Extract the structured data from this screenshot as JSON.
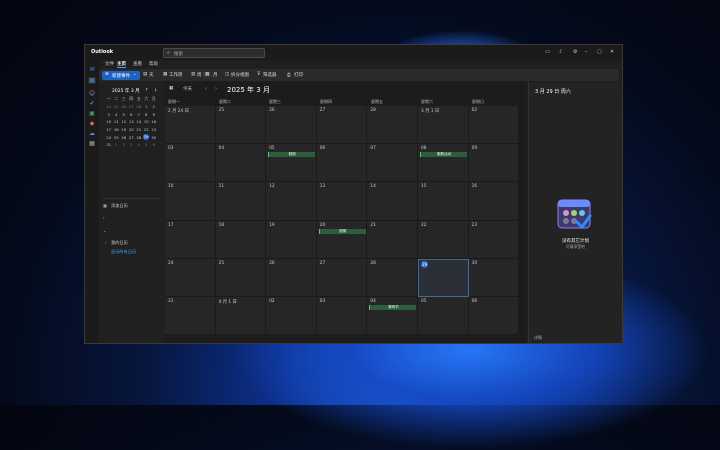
{
  "app": {
    "title": "Outlook"
  },
  "search": {
    "placeholder": "搜索"
  },
  "ribbon": {
    "tabs": [
      "文件",
      "主页",
      "查看",
      "帮助"
    ],
    "active_index": 1
  },
  "toolbar": {
    "new_event": "新建事件",
    "day": "天",
    "work_week": "工作周",
    "week": "周",
    "month": "月",
    "split_view": "拆分视图",
    "filter": "筛选器",
    "print": "打印"
  },
  "mini_calendar": {
    "title": "2025 年 3 月",
    "dows": [
      "一",
      "二",
      "三",
      "四",
      "五",
      "六",
      "日"
    ],
    "weeks": [
      [
        "24",
        "25",
        "26",
        "27",
        "28",
        "1",
        "2"
      ],
      [
        "3",
        "4",
        "5",
        "6",
        "7",
        "8",
        "9"
      ],
      [
        "10",
        "11",
        "12",
        "13",
        "14",
        "15",
        "16"
      ],
      [
        "17",
        "18",
        "19",
        "20",
        "21",
        "22",
        "23"
      ],
      [
        "24",
        "25",
        "26",
        "27",
        "28",
        "29",
        "30"
      ],
      [
        "31",
        "1",
        "2",
        "3",
        "4",
        "5",
        "6"
      ]
    ],
    "selected": "29"
  },
  "nav": {
    "add_calendar": "添加日历",
    "my_calendars": "我的日历",
    "show_all": "显示所有日历"
  },
  "calendar": {
    "today_label": "今天",
    "month_title": "2025 年 3 月",
    "dow": [
      "星期一",
      "星期二",
      "星期三",
      "星期四",
      "星期五",
      "星期六",
      "星期日"
    ],
    "weeks": [
      [
        "2 月 24 日",
        "25",
        "26",
        "27",
        "28",
        "3 月 1 日",
        "02"
      ],
      [
        "03",
        "04",
        "05",
        "06",
        "07",
        "08",
        "09"
      ],
      [
        "10",
        "11",
        "12",
        "13",
        "14",
        "15",
        "16"
      ],
      [
        "17",
        "18",
        "19",
        "20",
        "21",
        "22",
        "23"
      ],
      [
        "24",
        "25",
        "26",
        "27",
        "28",
        "29",
        "30"
      ],
      [
        "31",
        "4 月 1 日",
        "02",
        "03",
        "04",
        "05",
        "06"
      ]
    ],
    "today_cell": "29",
    "events": [
      {
        "week": 1,
        "day": 2,
        "label": "假期"
      },
      {
        "week": 1,
        "day": 5,
        "label": "假期活动"
      },
      {
        "week": 3,
        "day": 3,
        "label": "假期"
      },
      {
        "week": 5,
        "day": 4,
        "label": "清明节"
      }
    ]
  },
  "right_pane": {
    "title": "3 月 29 日 周六",
    "caption": "没有其它计划",
    "subcaption": "尽情享受吧",
    "footer": "详情"
  }
}
